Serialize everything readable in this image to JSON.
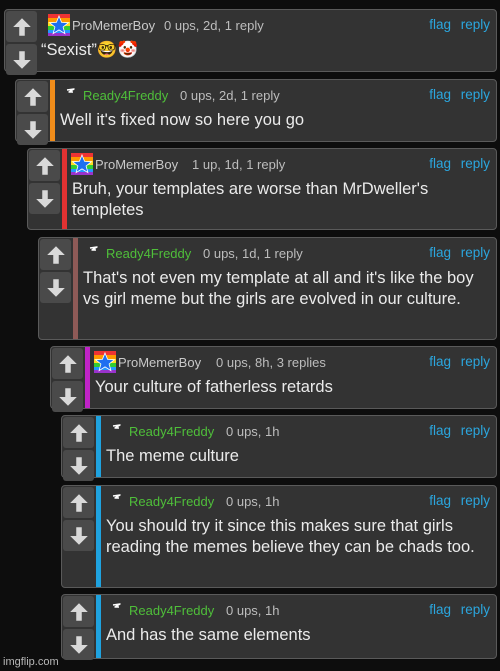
{
  "actions": {
    "flag": "flag",
    "reply": "reply"
  },
  "comments": [
    {
      "user": "ProMemerBoy",
      "meta": "0 ups, 2d, 1 reply",
      "body": "“Sexist”🤓🤡",
      "avatar": "rainbow-star-icon",
      "bar_color": "",
      "user_color": "#c9c9c9"
    },
    {
      "user": "Ready4Freddy",
      "meta": "0 ups, 2d, 1 reply",
      "body": "Well it's fixed now so here you go",
      "avatar": "lightning-icon",
      "bar_color": "#f08c1a",
      "user_color": "#4fbf3a"
    },
    {
      "user": "ProMemerBoy",
      "meta": "1 up, 1d, 1 reply",
      "body": "Bruh, your templates are worse than MrDweller's templetes",
      "avatar": "rainbow-star-icon",
      "bar_color": "#e23232",
      "user_color": "#c9c9c9"
    },
    {
      "user": "Ready4Freddy",
      "meta": "0 ups, 1d, 1 reply",
      "body": "That's not even my template at all and it's like the boy vs girl meme but the girls are evolved in our culture.",
      "avatar": "lightning-icon",
      "bar_color": "#8e5a57",
      "user_color": "#4fbf3a"
    },
    {
      "user": "ProMemerBoy",
      "meta": "0 ups, 8h, 3 replies",
      "body": "Your culture of fatherless retards",
      "avatar": "rainbow-star-icon",
      "bar_color": "#c023c7",
      "user_color": "#c9c9c9"
    },
    {
      "user": "Ready4Freddy",
      "meta": "0 ups, 1h",
      "body": "The meme culture",
      "avatar": "lightning-icon",
      "bar_color": "#1fa3e0",
      "user_color": "#4fbf3a"
    },
    {
      "user": "Ready4Freddy",
      "meta": "0 ups, 1h",
      "body": "You should try it since this makes sure that girls reading the memes believe they can be chads too.",
      "avatar": "lightning-icon",
      "bar_color": "#1fa3e0",
      "user_color": "#4fbf3a"
    },
    {
      "user": "Ready4Freddy",
      "meta": "0 ups, 1h",
      "body": "And has the same elements",
      "avatar": "lightning-icon",
      "bar_color": "#1fa3e0",
      "user_color": "#4fbf3a"
    }
  ],
  "watermark": "imgflip.com"
}
